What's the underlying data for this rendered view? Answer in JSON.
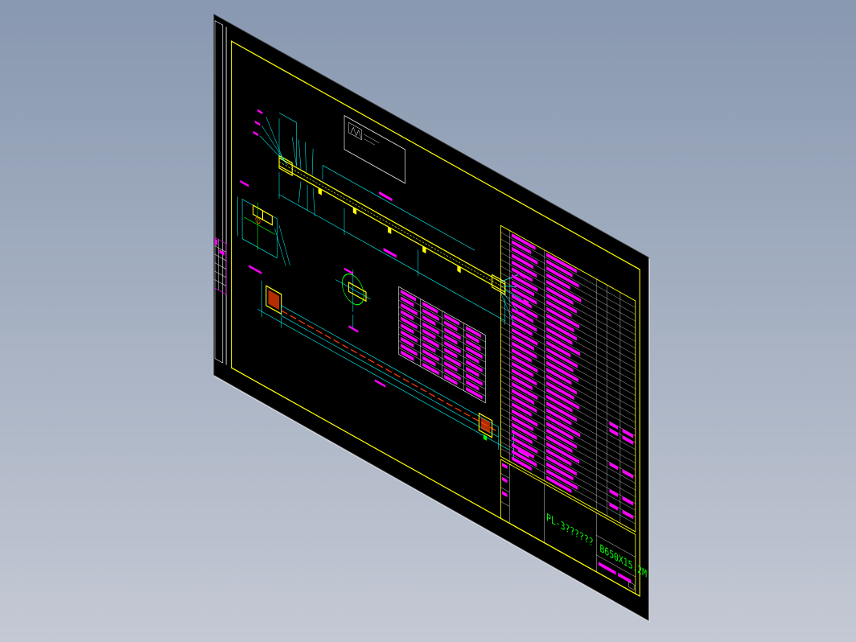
{
  "viewport": {
    "background_top": "#8898b0",
    "background_bottom": "#c4c9d4"
  },
  "drawing_sheet": {
    "background": "#000000",
    "border_color": "#ffff00",
    "line_colors": {
      "dimension": "#00ffff",
      "part": "#ffff00",
      "text": "#ff00ff",
      "title": "#00ff00",
      "section": "#ff4000",
      "frame": "#ffffff"
    }
  },
  "title_block": {
    "drawing_number": "PL-3??????",
    "model_code": "B650X15.2M"
  },
  "icons": [
    "cad-drawing-sheet-icon"
  ]
}
